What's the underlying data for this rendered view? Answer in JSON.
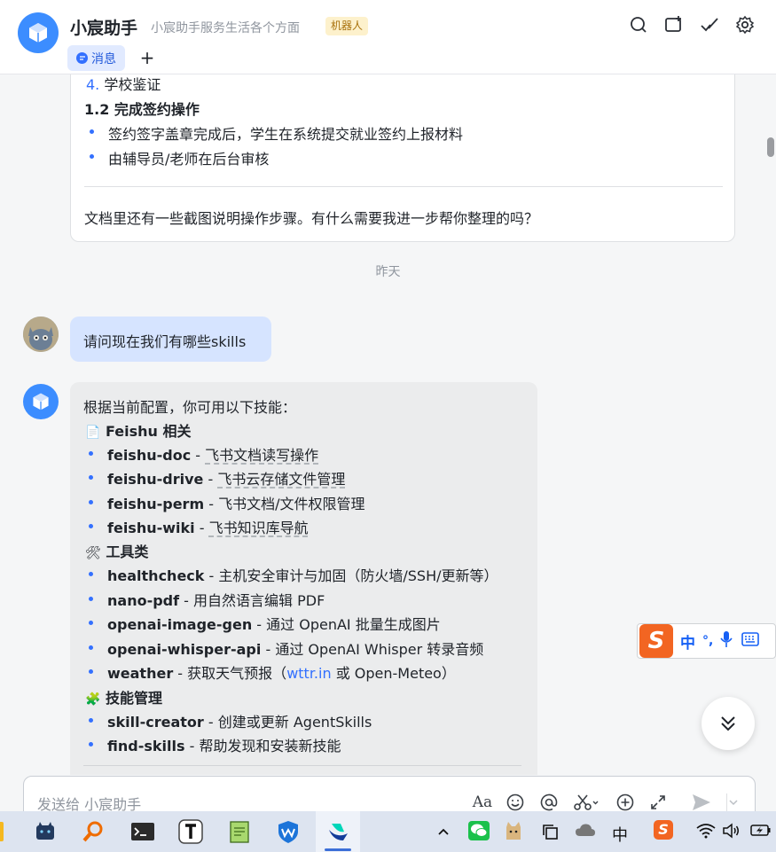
{
  "header": {
    "title": "小宸助手",
    "subtitle": "小宸助手服务生活各个方面",
    "tag": "机器人",
    "tab_messages": "消息",
    "tab_add": "+"
  },
  "prev_message": {
    "item4_num": "4.",
    "item4_text": "学校鉴证",
    "section_heading": "1.2 完成签约操作",
    "bullets": [
      "签约签字盖章完成后，学生在系统提交就业签约上报材料",
      "由辅导员/老师在后台审核"
    ],
    "closing": "文档里还有一些截图说明操作步骤。有什么需要我进一步帮你整理的吗？"
  },
  "date_separator": "昨天",
  "user_message": "请问现在我们有哪些skills",
  "bot_reply": {
    "intro": "根据当前配置，你可用以下技能：",
    "group1_icon": "📄",
    "group1_title": "Feishu 相关",
    "group1": [
      {
        "name": "feishu-doc",
        "sep": " - ",
        "desc": "飞书文档读写操作"
      },
      {
        "name": "feishu-drive",
        "sep": " - ",
        "desc": "飞书云存储文件管理"
      },
      {
        "name": "feishu-perm",
        "sep": " - ",
        "desc": "飞书文档/文件权限管理"
      },
      {
        "name": "feishu-wiki",
        "sep": " - ",
        "desc": "飞书知识库导航"
      }
    ],
    "group2_icon": "🛠",
    "group2_title": "工具类",
    "group2": [
      {
        "name": "healthcheck",
        "sep": " - ",
        "desc": "主机安全审计与加固（防火墙/SSH/更新等）"
      },
      {
        "name": "nano-pdf",
        "sep": " - ",
        "desc": "用自然语言编辑 PDF"
      },
      {
        "name": "openai-image-gen",
        "sep": " - ",
        "desc": "通过 OpenAI 批量生成图片"
      },
      {
        "name": "openai-whisper-api",
        "sep": " - ",
        "desc": "通过 OpenAI Whisper 转录音频"
      },
      {
        "name": "weather",
        "sep": " - ",
        "desc_a": "获取天气预报（",
        "link": "wttr.in",
        "desc_b": " 或 Open-Meteo）"
      }
    ],
    "group3_icon": "🧩",
    "group3_title": "技能管理",
    "group3": [
      {
        "name": "skill-creator",
        "sep": " - ",
        "desc": "创建或更新 AgentSkills"
      },
      {
        "name": "find-skills",
        "sep": " - ",
        "desc": "帮助发现和安装新技能"
      }
    ]
  },
  "ime": {
    "mode": "中",
    "punct": "°,"
  },
  "input": {
    "placeholder": "发送给 小宸助手",
    "font_label": "Aa"
  },
  "taskbar": {
    "ime_label": "中"
  },
  "colors": {
    "accent": "#3370ff",
    "bot_avatar": "#3c8dff",
    "user_bubble": "#d6e4ff",
    "bot_bubble": "#ebeced"
  }
}
